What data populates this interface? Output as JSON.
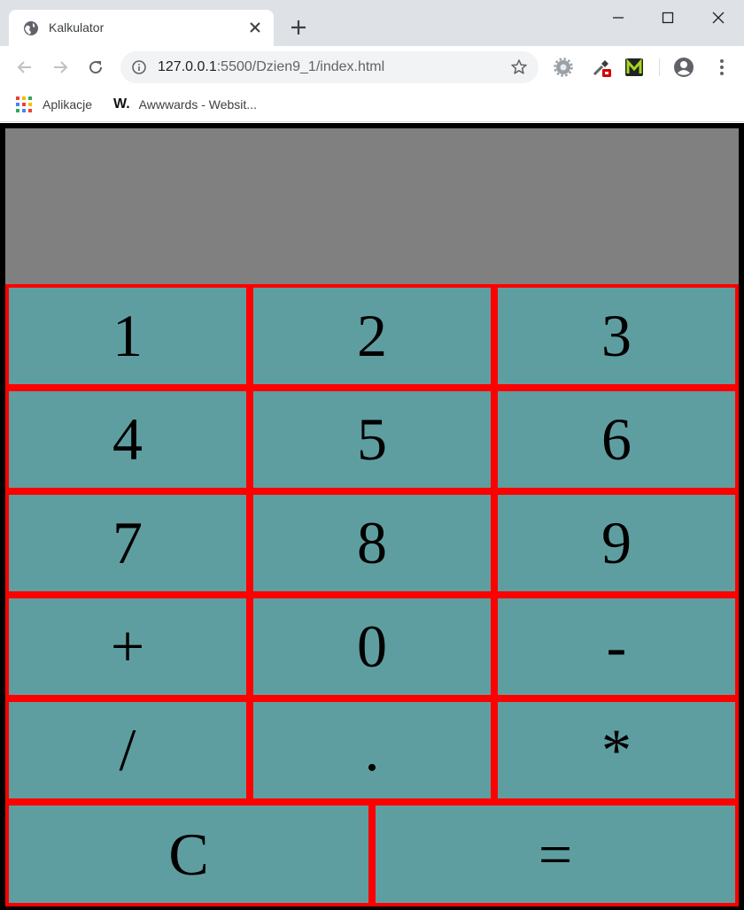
{
  "browser": {
    "tab_title": "Kalkulator",
    "url_host": "127.0.0.1",
    "url_rest": ":5500/Dzien9_1/index.html",
    "bookmarks": [
      {
        "label": "Aplikacje",
        "icon": "apps-grid-icon"
      },
      {
        "label": "Awwwards - Websit...",
        "icon": "awwwards-logo-icon"
      }
    ],
    "awwwards_logo_text": "W."
  },
  "calculator": {
    "display_value": "",
    "keys": {
      "one": "1",
      "two": "2",
      "three": "3",
      "four": "4",
      "five": "5",
      "six": "6",
      "seven": "7",
      "eight": "8",
      "nine": "9",
      "plus": "+",
      "zero": "0",
      "minus": "-",
      "divide": "/",
      "dot": ".",
      "multiply": "*",
      "clear": "C",
      "equals": "="
    }
  },
  "colors": {
    "display_background": "#808080",
    "key_background": "#5f9ea0",
    "key_border": "#ff0000",
    "page_background": "#000000"
  }
}
